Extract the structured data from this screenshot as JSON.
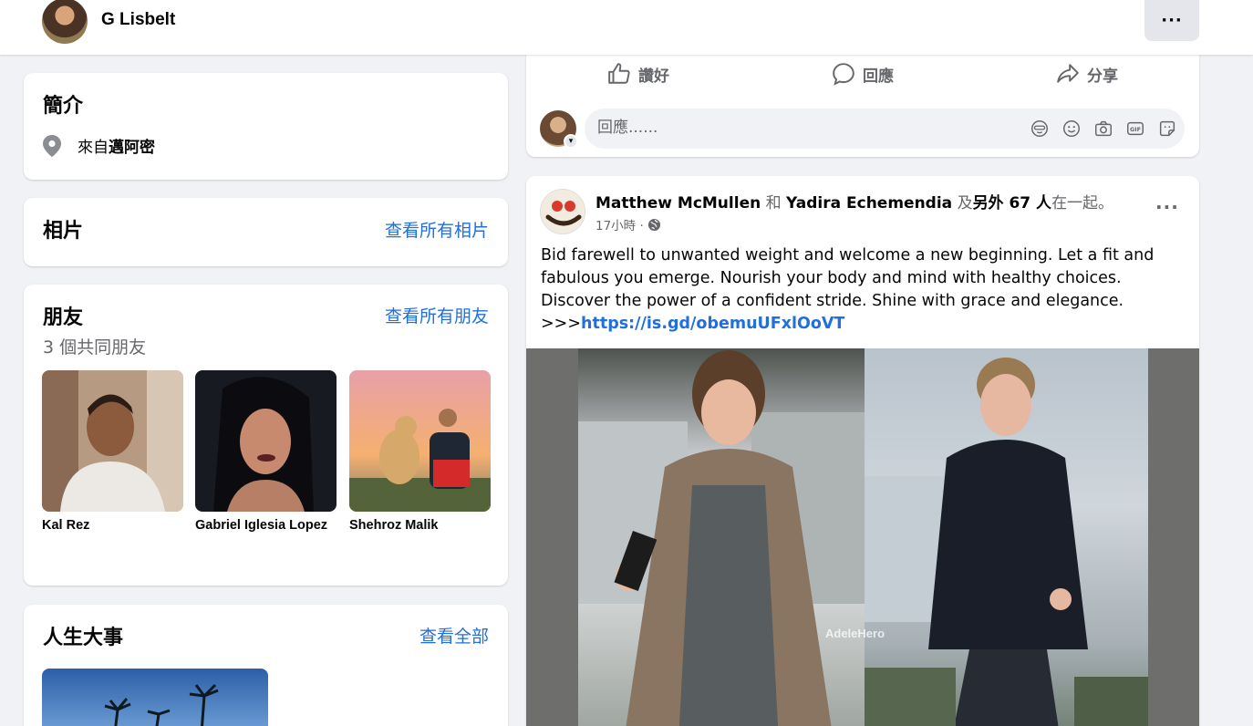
{
  "profile": {
    "name": "G Lisbelt",
    "more_label": "···"
  },
  "intro": {
    "title": "簡介",
    "from_prefix": "來自",
    "from_place": "邁阿密"
  },
  "photos": {
    "title": "相片",
    "see_all": "查看所有相片"
  },
  "friends": {
    "title": "朋友",
    "see_all": "查看所有朋友",
    "mutual": "3 個共同朋友",
    "list": [
      {
        "name": "Kal Rez"
      },
      {
        "name": "Gabriel Iglesia Lopez"
      },
      {
        "name": "Shehroz Malik"
      }
    ]
  },
  "life_events": {
    "title": "人生大事",
    "see_all": "查看全部"
  },
  "post_actions": {
    "like": "讚好",
    "comment": "回應",
    "share": "分享"
  },
  "comment_box": {
    "placeholder": "回應......"
  },
  "post": {
    "author": "Matthew McMullen",
    "and_word": "和",
    "tagged": "Yadira Echemendia",
    "with_prefix": "及",
    "others": "另外 67 人",
    "with_suffix": "在一起。",
    "time": "17小時 ·",
    "more_label": "···",
    "text": "Bid farewell to unwanted weight and welcome a new beginning. Let a fit and fabulous you emerge. Nourish your body and mind with healthy choices. Discover the power of a confident stride. Shine with grace and elegance.",
    "link_prefix": ">>>",
    "link": "https://is.gd/obemuUFxlOoVT",
    "watermark": "AdeleHero"
  }
}
